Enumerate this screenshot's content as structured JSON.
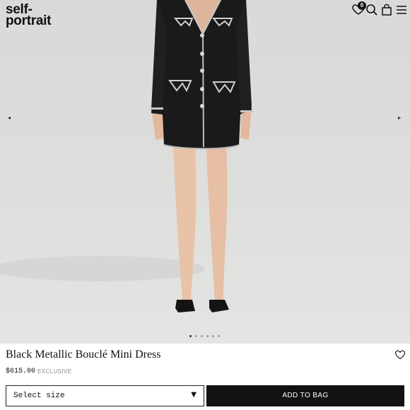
{
  "brand": {
    "line1": "self-",
    "line2": "portrait"
  },
  "header": {
    "wishlist_count": "0",
    "icons": [
      "heart-icon",
      "search-icon",
      "bag-icon",
      "menu-icon"
    ]
  },
  "carousel": {
    "prev_arrow": "◂",
    "next_arrow": "▸",
    "slide_count": 6,
    "active_slide": 1
  },
  "product": {
    "name": "Black Metallic Bouclé Mini Dress",
    "price": "$615.00",
    "badge": "EXCLUSIVE"
  },
  "size_select": {
    "value": "Select size",
    "caret": "▼"
  },
  "add_to_bag": {
    "label": "ADD TO BAG"
  },
  "colors": {
    "accent": "#111111",
    "background": "#ffffff",
    "photo_bg": "#dcdcda"
  }
}
